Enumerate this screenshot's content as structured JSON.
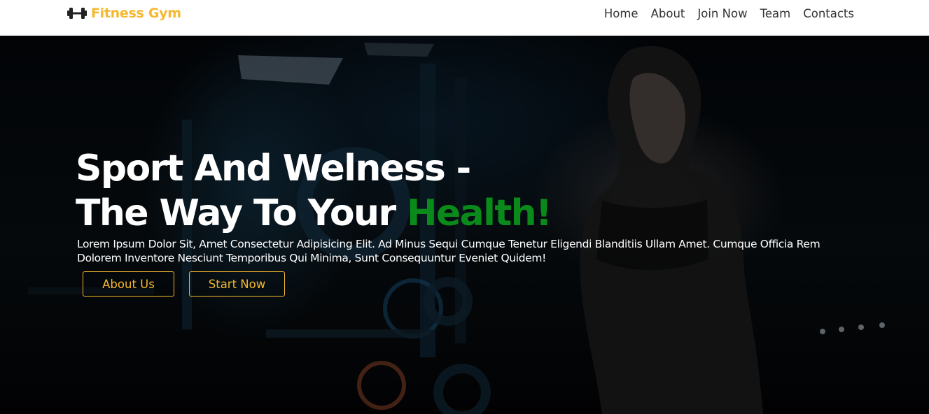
{
  "brand": {
    "name": "Fitness Gym",
    "icon": "dumbbell-icon",
    "color": "#f5b82e"
  },
  "nav": {
    "items": [
      {
        "label": "Home"
      },
      {
        "label": "About"
      },
      {
        "label": "Join Now"
      },
      {
        "label": "Team"
      },
      {
        "label": "Contacts"
      }
    ]
  },
  "hero": {
    "title_line1": "Sport And Welness -",
    "title_line2_prefix": "The Way To Your ",
    "title_line2_accent": "Health!",
    "accent_color": "#0a8a1a",
    "description": "Lorem Ipsum Dolor Sit, Amet Consectetur Adipisicing Elit. Ad Minus Sequi Cumque Tenetur Eligendi Blanditiis Ullam Amet. Cumque Officia Rem Dolorem Inventore Nesciunt Temporibus Qui Minima, Sunt Consequuntur Eveniet Quidem!",
    "buttons": {
      "about": "About Us",
      "start": "Start Now"
    },
    "button_color": "#f5b82e"
  }
}
